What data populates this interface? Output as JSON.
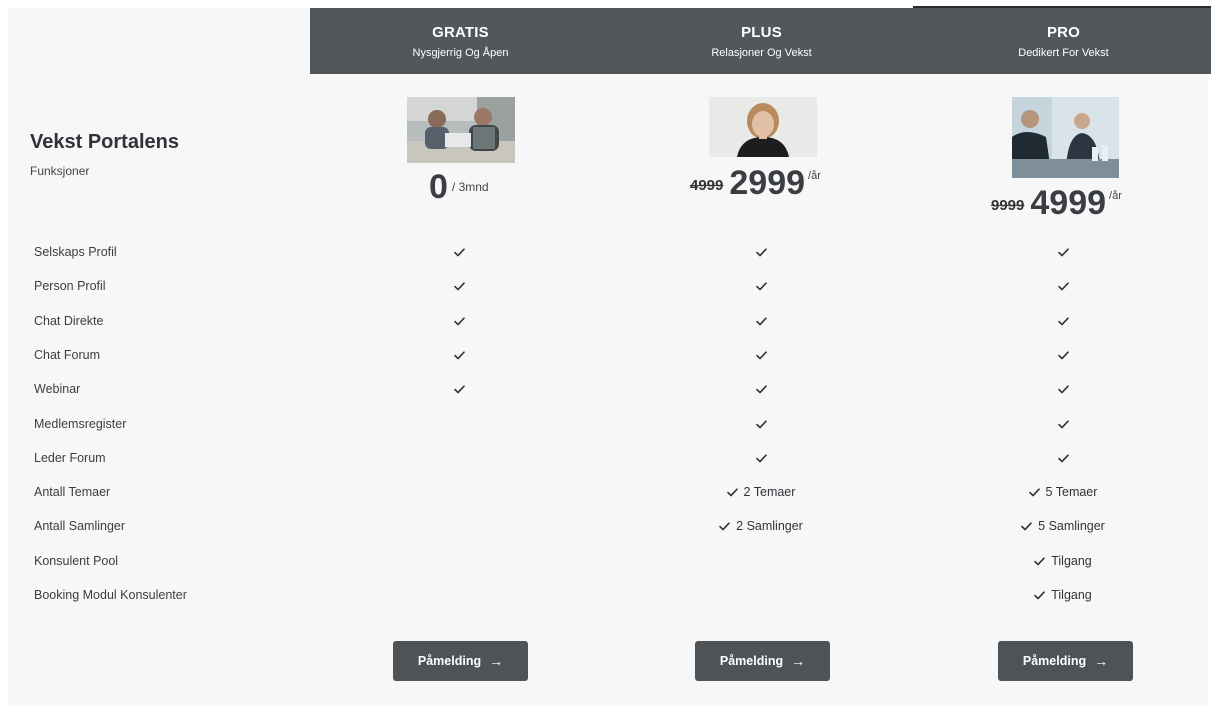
{
  "title": {
    "heading": "Vekst Portalens",
    "subheading": "Funksjoner"
  },
  "plans": [
    {
      "name": "GRATIS",
      "tagline": "Nysgjerrig Og Åpen",
      "old_price": "",
      "price": "0",
      "period": "/ 3mnd",
      "cta": "Påmelding"
    },
    {
      "name": "PLUS",
      "tagline": "Relasjoner Og Vekst",
      "old_price": "4999",
      "price": "2999",
      "period": "/år",
      "cta": "Påmelding"
    },
    {
      "name": "PRO",
      "tagline": "Dedikert For Vekst",
      "old_price": "9999",
      "price": "4999",
      "period": "/år",
      "cta": "Påmelding"
    }
  ],
  "features": [
    {
      "label": "Selskaps Profil",
      "cells": [
        {
          "check": true,
          "text": ""
        },
        {
          "check": true,
          "text": ""
        },
        {
          "check": true,
          "text": ""
        }
      ]
    },
    {
      "label": "Person Profil",
      "cells": [
        {
          "check": true,
          "text": ""
        },
        {
          "check": true,
          "text": ""
        },
        {
          "check": true,
          "text": ""
        }
      ]
    },
    {
      "label": "Chat Direkte",
      "cells": [
        {
          "check": true,
          "text": ""
        },
        {
          "check": true,
          "text": ""
        },
        {
          "check": true,
          "text": ""
        }
      ]
    },
    {
      "label": "Chat Forum",
      "cells": [
        {
          "check": true,
          "text": ""
        },
        {
          "check": true,
          "text": ""
        },
        {
          "check": true,
          "text": ""
        }
      ]
    },
    {
      "label": "Webinar",
      "cells": [
        {
          "check": true,
          "text": ""
        },
        {
          "check": true,
          "text": ""
        },
        {
          "check": true,
          "text": ""
        }
      ]
    },
    {
      "label": "Medlemsregister",
      "cells": [
        {
          "check": false,
          "text": ""
        },
        {
          "check": true,
          "text": ""
        },
        {
          "check": true,
          "text": ""
        }
      ]
    },
    {
      "label": "Leder Forum",
      "cells": [
        {
          "check": false,
          "text": ""
        },
        {
          "check": true,
          "text": ""
        },
        {
          "check": true,
          "text": ""
        }
      ]
    },
    {
      "label": "Antall Temaer",
      "cells": [
        {
          "check": false,
          "text": ""
        },
        {
          "check": true,
          "text": "2 Temaer"
        },
        {
          "check": true,
          "text": "5 Temaer"
        }
      ]
    },
    {
      "label": "Antall Samlinger",
      "cells": [
        {
          "check": false,
          "text": ""
        },
        {
          "check": true,
          "text": "2 Samlinger"
        },
        {
          "check": true,
          "text": "5 Samlinger"
        }
      ]
    },
    {
      "label": "Konsulent Pool",
      "cells": [
        {
          "check": false,
          "text": ""
        },
        {
          "check": false,
          "text": ""
        },
        {
          "check": true,
          "text": "Tilgang"
        }
      ]
    },
    {
      "label": "Booking Modul Konsulenter",
      "cells": [
        {
          "check": false,
          "text": ""
        },
        {
          "check": false,
          "text": ""
        },
        {
          "check": true,
          "text": "Tilgang"
        }
      ]
    }
  ],
  "icons": {
    "check": "check-icon",
    "cta_arrow": "arrow-right-icon"
  },
  "colors": {
    "header_bg": "#52575c",
    "button_bg": "#4e5358",
    "panel_bg": "#f7f7f7"
  }
}
